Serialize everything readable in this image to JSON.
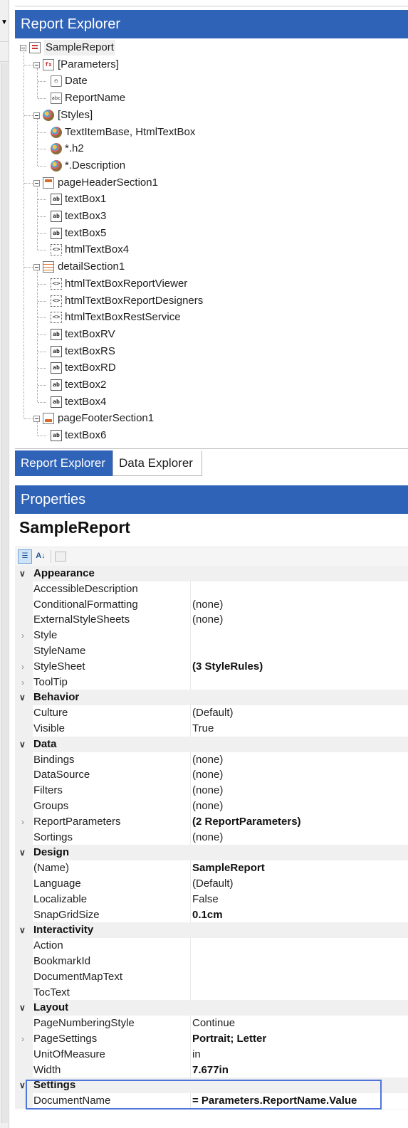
{
  "report_explorer": {
    "title": "Report Explorer",
    "tree": [
      {
        "label": "SampleReport",
        "icon": "report-icon",
        "depth": 0,
        "expanded": true
      },
      {
        "label": "[Parameters]",
        "icon": "parameters-icon",
        "depth": 1,
        "expanded": true
      },
      {
        "label": "Date",
        "icon": "date-parameter-icon",
        "depth": 2
      },
      {
        "label": "ReportName",
        "icon": "string-parameter-icon",
        "depth": 2
      },
      {
        "label": "[Styles]",
        "icon": "style-icon",
        "depth": 1,
        "expanded": true
      },
      {
        "label": "TextItemBase, HtmlTextBox",
        "icon": "style-icon",
        "depth": 2
      },
      {
        "label": "*.h2",
        "icon": "style-icon",
        "depth": 2
      },
      {
        "label": "*.Description",
        "icon": "style-icon",
        "depth": 2
      },
      {
        "label": "pageHeaderSection1",
        "icon": "page-header-icon",
        "depth": 1,
        "expanded": true
      },
      {
        "label": "textBox1",
        "icon": "textbox-icon",
        "depth": 2
      },
      {
        "label": "textBox3",
        "icon": "textbox-icon",
        "depth": 2
      },
      {
        "label": "textBox5",
        "icon": "textbox-icon",
        "depth": 2
      },
      {
        "label": "htmlTextBox4",
        "icon": "html-textbox-icon",
        "depth": 2
      },
      {
        "label": "detailSection1",
        "icon": "detail-section-icon",
        "depth": 1,
        "expanded": true
      },
      {
        "label": "htmlTextBoxReportViewer",
        "icon": "html-textbox-icon",
        "depth": 2
      },
      {
        "label": "htmlTextBoxReportDesigners",
        "icon": "html-textbox-icon",
        "depth": 2
      },
      {
        "label": "htmlTextBoxRestService",
        "icon": "html-textbox-icon",
        "depth": 2
      },
      {
        "label": "textBoxRV",
        "icon": "textbox-icon",
        "depth": 2
      },
      {
        "label": "textBoxRS",
        "icon": "textbox-icon",
        "depth": 2
      },
      {
        "label": "textBoxRD",
        "icon": "textbox-icon",
        "depth": 2
      },
      {
        "label": "textBox2",
        "icon": "textbox-icon",
        "depth": 2
      },
      {
        "label": "textBox4",
        "icon": "textbox-icon",
        "depth": 2
      },
      {
        "label": "pageFooterSection1",
        "icon": "page-footer-icon",
        "depth": 1,
        "expanded": true
      },
      {
        "label": "textBox6",
        "icon": "textbox-icon",
        "depth": 2
      }
    ]
  },
  "tabs": [
    {
      "label": "Report Explorer",
      "active": true
    },
    {
      "label": "Data Explorer",
      "active": false
    }
  ],
  "properties": {
    "title": "Properties",
    "object_name": "SampleReport",
    "toolbar": [
      "categorized-icon",
      "alphabetical-icon",
      "property-pages-icon"
    ],
    "rows": [
      {
        "type": "category",
        "name": "Appearance"
      },
      {
        "type": "prop",
        "name": "AccessibleDescription",
        "value": ""
      },
      {
        "type": "prop",
        "name": "ConditionalFormatting",
        "value": "(none)"
      },
      {
        "type": "prop",
        "name": "ExternalStyleSheets",
        "value": "(none)"
      },
      {
        "type": "prop",
        "name": "Style",
        "value": "",
        "expandable": true
      },
      {
        "type": "prop",
        "name": "StyleName",
        "value": ""
      },
      {
        "type": "prop",
        "name": "StyleSheet",
        "value": "(3 StyleRules)",
        "bold": true,
        "expandable": true
      },
      {
        "type": "prop",
        "name": "ToolTip",
        "value": "",
        "expandable": true
      },
      {
        "type": "category",
        "name": "Behavior"
      },
      {
        "type": "prop",
        "name": "Culture",
        "value": "(Default)"
      },
      {
        "type": "prop",
        "name": "Visible",
        "value": "True"
      },
      {
        "type": "category",
        "name": "Data"
      },
      {
        "type": "prop",
        "name": "Bindings",
        "value": "(none)"
      },
      {
        "type": "prop",
        "name": "DataSource",
        "value": "(none)"
      },
      {
        "type": "prop",
        "name": "Filters",
        "value": "(none)"
      },
      {
        "type": "prop",
        "name": "Groups",
        "value": "(none)"
      },
      {
        "type": "prop",
        "name": "ReportParameters",
        "value": "(2 ReportParameters)",
        "bold": true,
        "expandable": true
      },
      {
        "type": "prop",
        "name": "Sortings",
        "value": "(none)"
      },
      {
        "type": "category",
        "name": "Design"
      },
      {
        "type": "prop",
        "name": "(Name)",
        "value": "SampleReport",
        "bold": true
      },
      {
        "type": "prop",
        "name": "Language",
        "value": "(Default)"
      },
      {
        "type": "prop",
        "name": "Localizable",
        "value": "False"
      },
      {
        "type": "prop",
        "name": "SnapGridSize",
        "value": "0.1cm",
        "bold": true
      },
      {
        "type": "category",
        "name": "Interactivity"
      },
      {
        "type": "prop",
        "name": "Action",
        "value": ""
      },
      {
        "type": "prop",
        "name": "BookmarkId",
        "value": ""
      },
      {
        "type": "prop",
        "name": "DocumentMapText",
        "value": ""
      },
      {
        "type": "prop",
        "name": "TocText",
        "value": ""
      },
      {
        "type": "category",
        "name": "Layout"
      },
      {
        "type": "prop",
        "name": "PageNumberingStyle",
        "value": "Continue"
      },
      {
        "type": "prop",
        "name": "PageSettings",
        "value": "Portrait; Letter",
        "bold": true,
        "expandable": true
      },
      {
        "type": "prop",
        "name": "UnitOfMeasure",
        "value": "in"
      },
      {
        "type": "prop",
        "name": "Width",
        "value": "7.677in",
        "bold": true
      },
      {
        "type": "category",
        "name": "Settings"
      },
      {
        "type": "prop",
        "name": "DocumentName",
        "value": "= Parameters.ReportName.Value",
        "bold": true
      }
    ]
  },
  "colors": {
    "header_bg": "#2f63b8",
    "highlight_border": "#4f74d9",
    "category_bg": "#f0f0f0"
  }
}
